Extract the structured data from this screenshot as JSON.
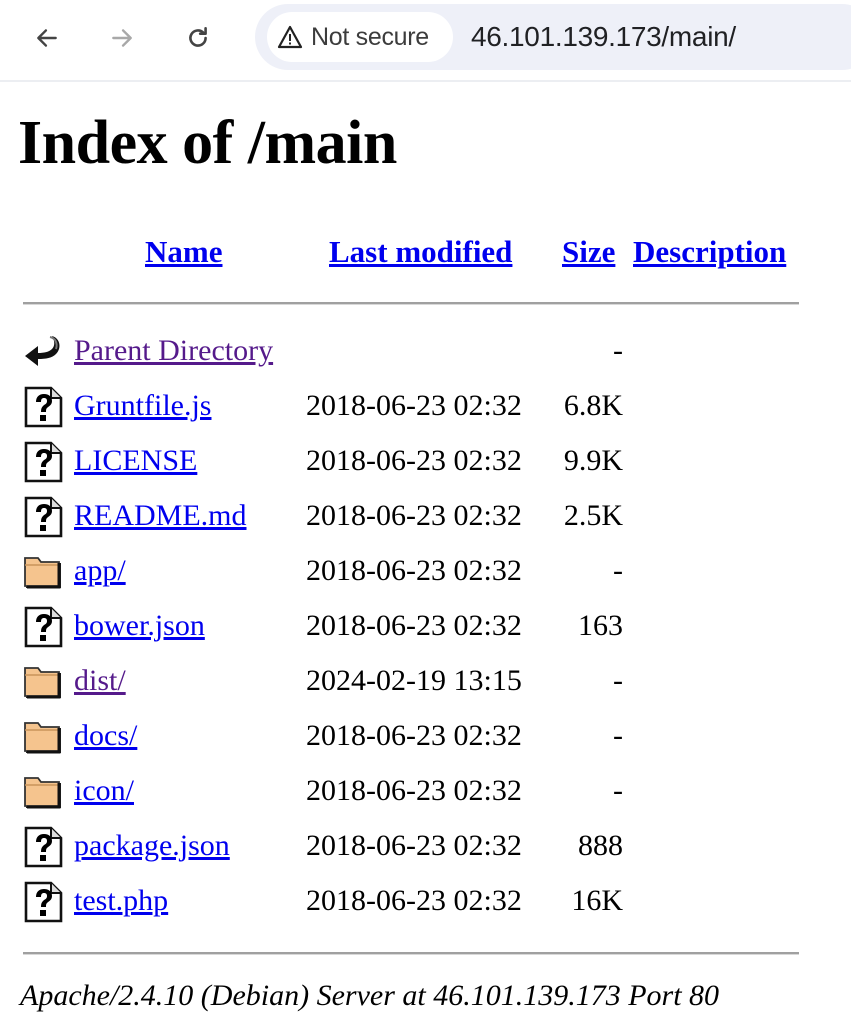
{
  "browser": {
    "back_icon": "arrow-left-icon",
    "forward_icon": "arrow-right-icon",
    "reload_icon": "reload-icon",
    "security_icon": "warning-triangle-icon",
    "security_label": "Not secure",
    "url": "46.101.139.173/main/"
  },
  "page": {
    "title": "Index of /main",
    "columns": {
      "name": "Name",
      "last_modified": "Last modified",
      "size": "Size",
      "description": "Description"
    },
    "entries": [
      {
        "icon": "parent-directory-icon",
        "name": "Parent Directory",
        "date": "",
        "size": "-",
        "visited": true
      },
      {
        "icon": "unknown-file-icon",
        "name": "Gruntfile.js",
        "date": "2018-06-23 02:32",
        "size": "6.8K",
        "visited": false
      },
      {
        "icon": "unknown-file-icon",
        "name": "LICENSE",
        "date": "2018-06-23 02:32",
        "size": "9.9K",
        "visited": false
      },
      {
        "icon": "unknown-file-icon",
        "name": "README.md",
        "date": "2018-06-23 02:32",
        "size": "2.5K",
        "visited": false
      },
      {
        "icon": "folder-icon",
        "name": "app/",
        "date": "2018-06-23 02:32",
        "size": "-",
        "visited": false
      },
      {
        "icon": "unknown-file-icon",
        "name": "bower.json",
        "date": "2018-06-23 02:32",
        "size": "163",
        "visited": false
      },
      {
        "icon": "folder-icon",
        "name": "dist/",
        "date": "2024-02-19 13:15",
        "size": "-",
        "visited": true
      },
      {
        "icon": "folder-icon",
        "name": "docs/",
        "date": "2018-06-23 02:32",
        "size": "-",
        "visited": false
      },
      {
        "icon": "folder-icon",
        "name": "icon/",
        "date": "2018-06-23 02:32",
        "size": "-",
        "visited": false
      },
      {
        "icon": "unknown-file-icon",
        "name": "package.json",
        "date": "2018-06-23 02:32",
        "size": "888",
        "visited": false
      },
      {
        "icon": "unknown-file-icon",
        "name": "test.php",
        "date": "2018-06-23 02:32",
        "size": "16K",
        "visited": false
      }
    ],
    "footer": "Apache/2.4.10 (Debian) Server at 46.101.139.173 Port 80"
  },
  "colors": {
    "link": "#0000ee",
    "visited_link": "#551a8b",
    "folder": "#f5c48e",
    "omnibox_bg": "#eef0f8"
  }
}
